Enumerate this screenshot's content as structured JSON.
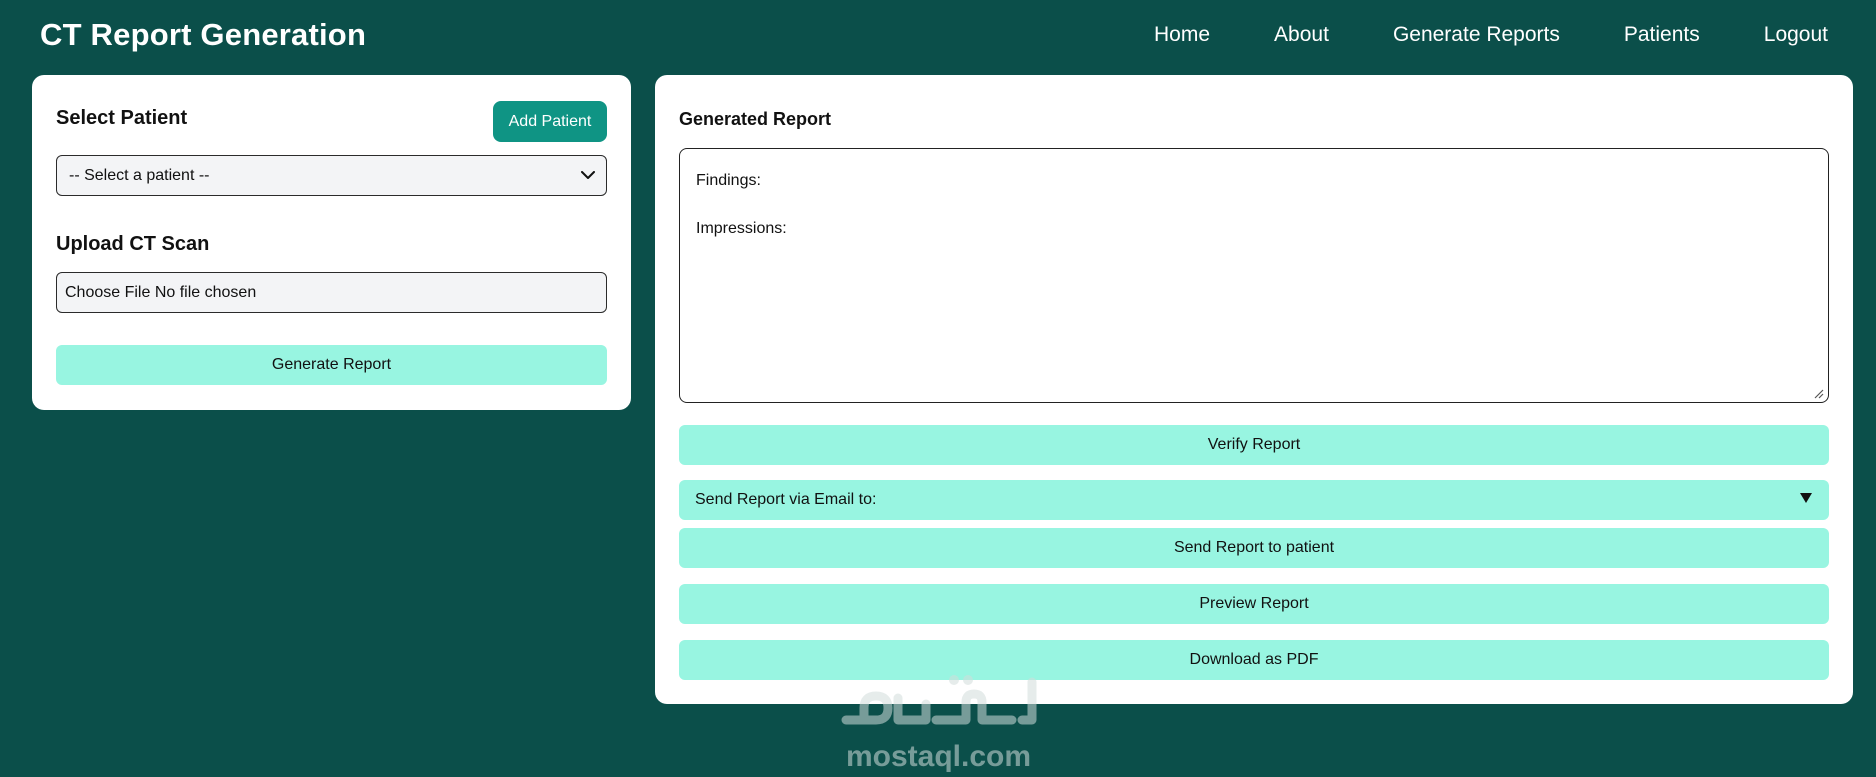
{
  "app": {
    "title": "CT Report Generation"
  },
  "nav": {
    "items": [
      "Home",
      "About",
      "Generate Reports",
      "Patients",
      "Logout"
    ]
  },
  "left_panel": {
    "select_title": "Select Patient",
    "add_button": "Add Patient",
    "patient_select_value": "-- Select a patient --",
    "upload_title": "Upload CT Scan",
    "file_input_text": "Choose File No file chosen",
    "generate_button": "Generate Report"
  },
  "right_panel": {
    "title": "Generated Report",
    "report_lines": [
      "Findings:",
      "Impressions:"
    ],
    "verify_button": "Verify Report",
    "email_label": "Send Report via Email to:",
    "send_button": "Send Report to patient",
    "preview_button": "Preview Report",
    "download_button": "Download as PDF"
  },
  "watermark": {
    "text": "mostaql.com"
  },
  "colors": {
    "background": "#0b4f4a",
    "card": "#ffffff",
    "accent": "#0f9484",
    "mint": "#98f5e1"
  }
}
